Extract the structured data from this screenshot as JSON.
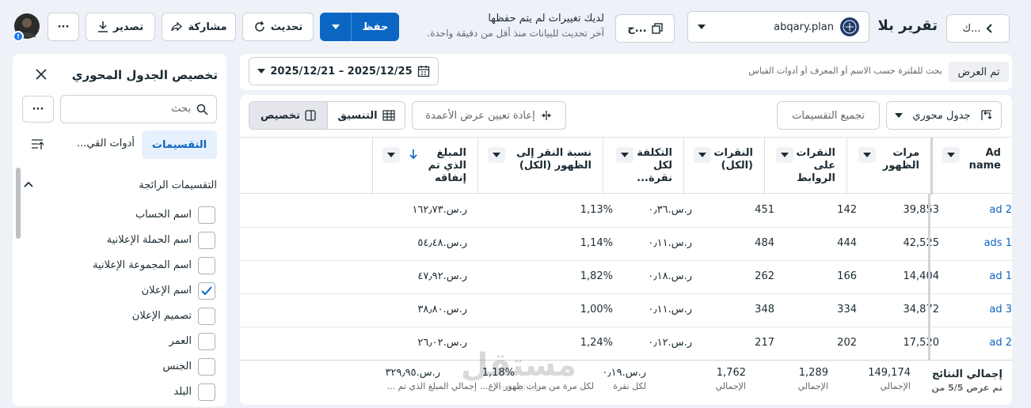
{
  "header": {
    "back_label": "ك...",
    "title": "تقرير بلا",
    "account": "abqary.plan",
    "account_badge": "عبقري بلان",
    "compare_label": "ح...",
    "unsaved_title": "لديك تغييرات لم يتم حفظها",
    "unsaved_sub": "آخر تحديث للبيانات منذ أقل من دقيقة واحدة.",
    "save_label": "حفظ",
    "refresh_label": "تحديث",
    "share_label": "مشاركة",
    "export_label": "تصدير",
    "more_label": "···"
  },
  "filter": {
    "applied_label": "تم العرض",
    "search_placeholder": "بحث للفلترة حسب الاسم أو المعرف أو أدوات القياس",
    "date_range": "2025/12/21 – 2025/12/25"
  },
  "toolbar": {
    "view_select": "جدول محوري",
    "group_breakdowns": "تجميع التقسيمات",
    "reset_widths": "إعادة تعيين عرض الأعمدة",
    "format_label": "التنسيق",
    "customize_label": "تخصيص"
  },
  "table": {
    "columns": [
      "Ad name",
      "مرات الظهور",
      "النقرات على الروابط",
      "النقرات (الكل)",
      "التكلفة لكل نقرة...",
      "نسبة النقر إلى الظهور (الكل)",
      "المبلغ الذي تم إنفاقه"
    ],
    "rows": [
      {
        "name": "ad 2",
        "impressions": "39,853",
        "link_clicks": "142",
        "clicks": "451",
        "cpc": "ر.س.٠٫٣٦",
        "ctr": "1,13%",
        "spent": "ر.س.١٦٢٫٧٣"
      },
      {
        "name": "ads 1",
        "impressions": "42,525",
        "link_clicks": "444",
        "clicks": "484",
        "cpc": "ر.س.٠٫١١",
        "ctr": "1,14%",
        "spent": "ر.س.٥٤٫٤٨"
      },
      {
        "name": "ad 1",
        "impressions": "14,404",
        "link_clicks": "166",
        "clicks": "262",
        "cpc": "ر.س.٠٫١٨",
        "ctr": "1,82%",
        "spent": "ر.س.٤٧٫٩٢"
      },
      {
        "name": "ad 3",
        "impressions": "34,872",
        "link_clicks": "334",
        "clicks": "348",
        "cpc": "ر.س.٠٫١١",
        "ctr": "1,00%",
        "spent": "ر.س.٣٨٫٨٠"
      },
      {
        "name": "ad 2",
        "impressions": "17,520",
        "link_clicks": "202",
        "clicks": "217",
        "cpc": "ر.س.٠٫١٢",
        "ctr": "1,24%",
        "spent": "ر.س.٢٦٫٠٢"
      }
    ],
    "totals": {
      "label": "إجمالي النتائج",
      "label_sub": "تم عرض 5/5 من",
      "impressions": "149,174",
      "impressions_sub": "الإجمالي",
      "link_clicks": "1,289",
      "link_clicks_sub": "الإجمالي",
      "clicks": "1,762",
      "clicks_sub": "الإجمالي",
      "cpc": "ر.س.٠٫١٩",
      "cpc_sub": "لكل نقرة",
      "ctr": "1,18%",
      "ctr_sub": "لكل مرة من مرات ظهور الإع...",
      "spent": "ر.س.٣٢٩٫٩٥",
      "spent_sub": "إجمالي المبلغ الذي تم ..."
    }
  },
  "sidebar": {
    "title": "تخصيص الجدول المحوري",
    "search_placeholder": "بحث",
    "more_label": "···",
    "tab_active": "التقسيمات",
    "tab_other": "أدوات القي...",
    "section_title": "التقسيمات الرائجة",
    "items": [
      {
        "label": "اسم الحساب",
        "checked": false
      },
      {
        "label": "اسم الحملة الإعلانية",
        "checked": false
      },
      {
        "label": "اسم المجموعة الإعلانية",
        "checked": false
      },
      {
        "label": "اسم الإعلان",
        "checked": true
      },
      {
        "label": "تصميم الإعلان",
        "checked": false
      },
      {
        "label": "العمر",
        "checked": false
      },
      {
        "label": "الجنس",
        "checked": false
      },
      {
        "label": "البلد",
        "checked": false
      }
    ]
  },
  "watermark": {
    "text": "مستقل",
    "sub": "mostaql.com"
  },
  "colors": {
    "primary": "#0a66c2",
    "accent": "#1877f2"
  }
}
